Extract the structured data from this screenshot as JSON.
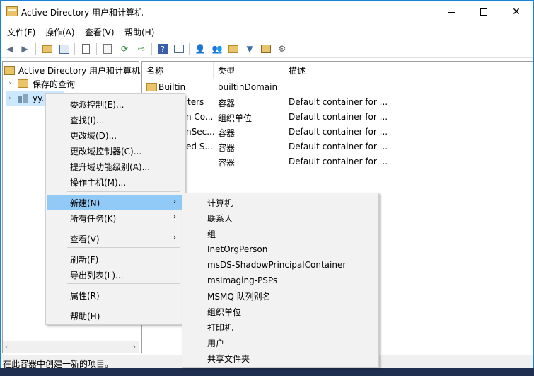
{
  "window": {
    "title": "Active Directory 用户和计算机",
    "close_glyph": "✕"
  },
  "menubar": {
    "items": [
      "文件(F)",
      "操作(A)",
      "查看(V)",
      "帮助(H)"
    ]
  },
  "tree": {
    "root": "Active Directory 用户和计算机",
    "saved_queries": "保存的查询",
    "domain": "yy.c"
  },
  "list": {
    "columns": [
      "名称",
      "类型",
      "描述"
    ],
    "rows": [
      {
        "name": "Builtin",
        "type": "builtinDomain",
        "desc": ""
      },
      {
        "name": "ters",
        "type": "容器",
        "desc": "Default container for ..."
      },
      {
        "name": "n Co...",
        "type": "组织单位",
        "desc": "Default container for ..."
      },
      {
        "name": "nSec...",
        "type": "容器",
        "desc": "Default container for ..."
      },
      {
        "name": "ed S...",
        "type": "容器",
        "desc": "Default container for ..."
      },
      {
        "name": "",
        "type": "容器",
        "desc": "Default container for ..."
      }
    ]
  },
  "context_menu": {
    "items": [
      "委派控制(E)...",
      "查找(I)...",
      "更改域(D)...",
      "更改域控制器(C)...",
      "提升域功能级别(A)...",
      "操作主机(M)...",
      "新建(N)",
      "所有任务(K)",
      "查看(V)",
      "刷新(F)",
      "导出列表(L)...",
      "属性(R)",
      "帮助(H)"
    ]
  },
  "submenu": {
    "items": [
      "计算机",
      "联系人",
      "组",
      "InetOrgPerson",
      "msDS-ShadowPrincipalContainer",
      "msImaging-PSPs",
      "MSMQ 队列别名",
      "组织单位",
      "打印机",
      "用户",
      "共享文件夹"
    ]
  },
  "statusbar": {
    "text": "在此容器中创建一新的项目。"
  },
  "colors": {
    "accent_border": "#1883d7",
    "menu_highlight": "#91c9f7",
    "selection": "#cce8ff"
  }
}
